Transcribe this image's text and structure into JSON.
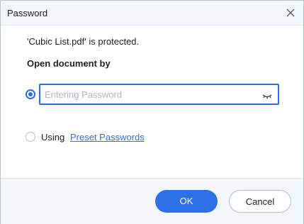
{
  "dialog": {
    "title": "Password",
    "message": "'Cubic List.pdf' is protected.",
    "section_label": "Open document by",
    "password_field": {
      "placeholder": "Entering Password",
      "value": "",
      "toggle_icon": "eye-closed-icon"
    },
    "options": {
      "entering_password_selected": true,
      "using_label": "Using",
      "preset_link": "Preset Passwords"
    },
    "buttons": {
      "ok": "OK",
      "cancel": "Cancel"
    }
  },
  "colors": {
    "accent": "#2d6fe6",
    "titlebar_bg": "#f3f6fa",
    "footer_bg": "#f3f6fa"
  }
}
